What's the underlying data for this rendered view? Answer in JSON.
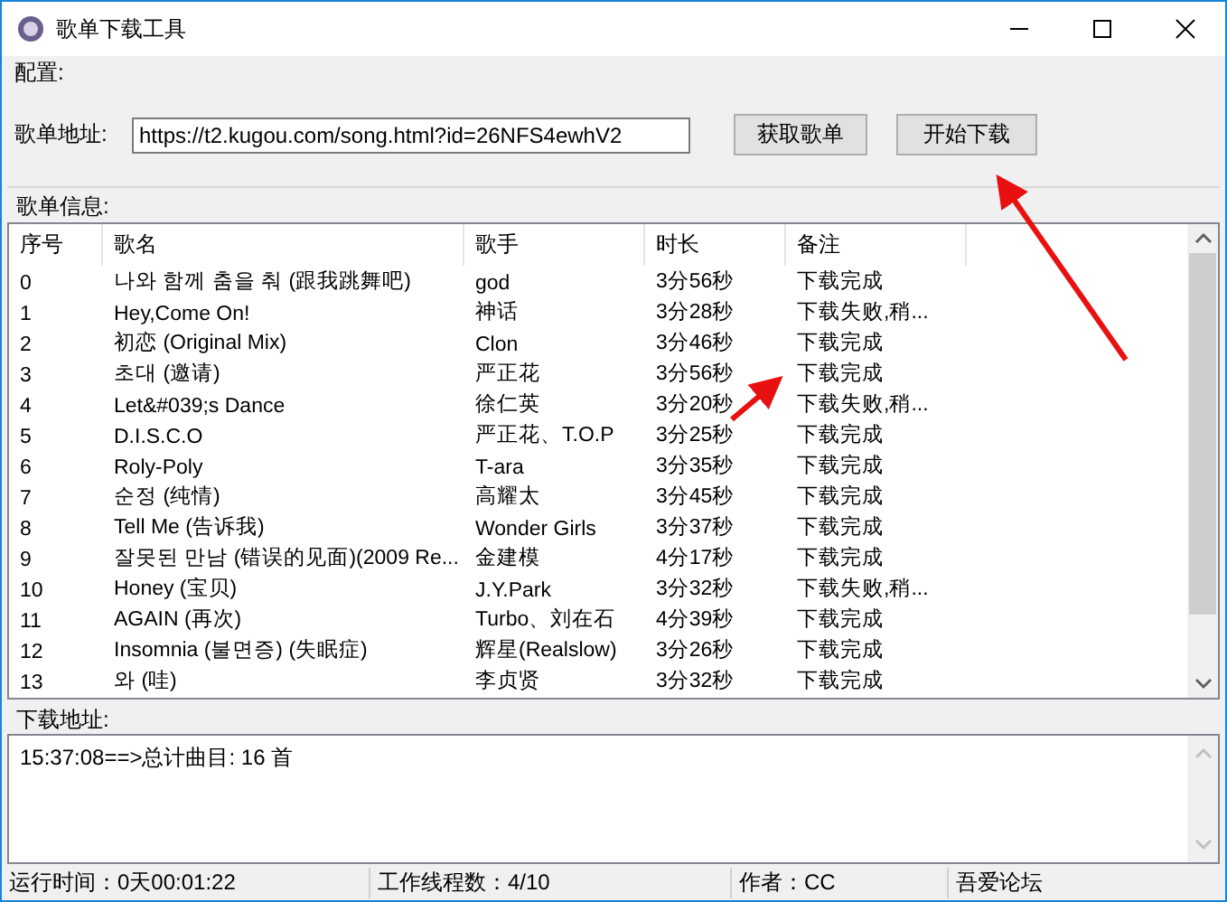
{
  "window": {
    "title": "歌单下载工具"
  },
  "config": {
    "label": "配置:",
    "url_label": "歌单地址:",
    "url_value": "https://t2.kugou.com/song.html?id=26NFS4ewhV2",
    "buttons": [
      "获取歌单",
      "开始下载"
    ]
  },
  "playlist": {
    "label": "歌单信息:",
    "columns": [
      "序号",
      "歌名",
      "歌手",
      "时长",
      "备注"
    ],
    "rows": [
      [
        "0",
        "나와 함께 춤을 춰 (跟我跳舞吧)",
        "god",
        "3分56秒",
        "下载完成"
      ],
      [
        "1",
        "Hey,Come On!",
        "神话",
        "3分28秒",
        "下载失败,稍..."
      ],
      [
        "2",
        "初恋 (Original Mix)",
        "Clon",
        "3分46秒",
        "下载完成"
      ],
      [
        "3",
        "초대 (邀请)",
        "严正花",
        "3分56秒",
        "下载完成"
      ],
      [
        "4",
        "Let&#039;s Dance",
        "徐仁英",
        "3分20秒",
        "下载失败,稍..."
      ],
      [
        "5",
        "D.I.S.C.O",
        "严正花、T.O.P",
        "3分25秒",
        "下载完成"
      ],
      [
        "6",
        "Roly-Poly",
        "T-ara",
        "3分35秒",
        "下载完成"
      ],
      [
        "7",
        "순정 (纯情)",
        "高耀太",
        "3分45秒",
        "下载完成"
      ],
      [
        "8",
        "Tell Me (告诉我)",
        "Wonder Girls",
        "3分37秒",
        "下载完成"
      ],
      [
        "9",
        "잘못된 만남 (错误的见面)(2009 Re...",
        "金建模",
        "4分17秒",
        "下载完成"
      ],
      [
        "10",
        "Honey (宝贝)",
        "J.Y.Park",
        "3分32秒",
        "下载失败,稍..."
      ],
      [
        "11",
        "AGAIN (再次)",
        "Turbo、刘在石",
        "4分39秒",
        "下载完成"
      ],
      [
        "12",
        "Insomnia (불면증) (失眠症)",
        "辉星(Realslow)",
        "3分26秒",
        "下载完成"
      ],
      [
        "13",
        "와 (哇)",
        "李贞贤",
        "3分32秒",
        "下载完成"
      ]
    ]
  },
  "download": {
    "label": "下载地址:",
    "log": [
      "15:37:08==>总计曲目: 16 首"
    ]
  },
  "status_bar": [
    "运行时间：0天00:01:22",
    "工作线程数：4/10",
    "作者：CC",
    "吾爱论坛"
  ]
}
